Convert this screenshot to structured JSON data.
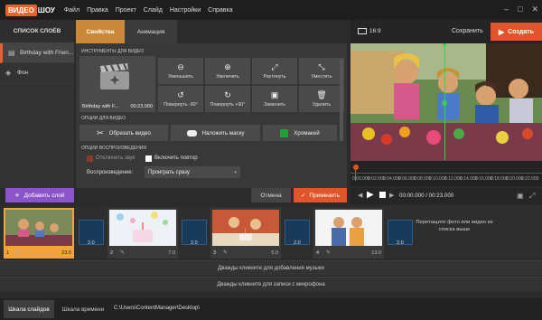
{
  "app": {
    "logo_video": "ВИДЕО",
    "logo_show": "ШОУ"
  },
  "menu": [
    "Файл",
    "Правка",
    "Проект",
    "Слайд",
    "Настройки",
    "Справка"
  ],
  "window_controls": {
    "minimize": "–",
    "maximize": "□",
    "close": "✕"
  },
  "layers": {
    "header": "СПИСОК СЛОЁВ",
    "items": [
      {
        "label": "Birthday with Frien...",
        "icon": "film-icon",
        "selected": true
      },
      {
        "label": "Фон",
        "icon": "paint-bucket-icon",
        "selected": false
      }
    ]
  },
  "tabs": {
    "properties": "Свойства",
    "animation": "Анимация"
  },
  "video_tools": {
    "section": "ИНСТРУМЕНТЫ ДЛЯ ВИДЕО",
    "clip_name": "Birthday with F...",
    "clip_time": "00:23.000",
    "buttons": [
      {
        "label": "Уменьшить",
        "icon": "zoom-out-icon"
      },
      {
        "label": "Увеличить",
        "icon": "zoom-in-icon"
      },
      {
        "label": "Растянуть",
        "icon": "stretch-icon"
      },
      {
        "label": "Уместить",
        "icon": "fit-icon"
      },
      {
        "label": "Повернуть -90°",
        "icon": "rotate-left-icon"
      },
      {
        "label": "Повернуть +90°",
        "icon": "rotate-right-icon"
      },
      {
        "label": "Заменить",
        "icon": "replace-icon"
      },
      {
        "label": "Удалить",
        "icon": "trash-icon"
      }
    ]
  },
  "video_options": {
    "section": "ОПЦИИ ДЛЯ ВИДЕО",
    "trim": "Обрезать видео",
    "mask": "Наложить маску",
    "chroma": "Хромакей"
  },
  "playback": {
    "section": "ОПЦИИ ВОСПРОИЗВЕДЕНИЯ",
    "mute_label": "Отключить звук",
    "mute_checked": true,
    "repeat_label": "Включить повтор",
    "repeat_checked": false,
    "mode_label": "Воспроизведение:",
    "mode_value": "Проиграть сразу"
  },
  "preview": {
    "ratio": "16:9",
    "save": "Сохранить",
    "create": "Создать",
    "ticks": [
      "0:00.000",
      "0:02.000",
      "0:04.000",
      "0:06.000",
      "0:08.000",
      "0:10.000",
      "0:12.000",
      "0:14.000",
      "0:16.000",
      "0:18.000",
      "0:20.000",
      "0:22.000"
    ],
    "timecode": "00:00.000 / 00:23.000"
  },
  "actions": {
    "add_layer": "Добавить слой",
    "cancel": "Отмена",
    "apply": "Применить"
  },
  "slides": [
    {
      "num": "1",
      "dur": "23.0",
      "selected": true
    },
    {
      "num": "2",
      "dur": "7.0",
      "selected": false
    },
    {
      "num": "3",
      "dur": "5.0",
      "selected": false
    },
    {
      "num": "4",
      "dur": "13.0",
      "selected": false
    }
  ],
  "transitions": [
    "2.0",
    "2.0",
    "2.0",
    "2.0"
  ],
  "drop_hint": "Перетащите фото или видео из списка выше",
  "audio": {
    "music": "Дважды кликните для добавления музыки",
    "mic": "Дважды кликните для записи с микрофона"
  },
  "bottom": {
    "slides_tab": "Шкала слайдов",
    "timeline_tab": "Шкала времени",
    "path": "C:\\Users\\ContentManager\\Desktop\\"
  },
  "colors": {
    "accent": "#e8632b",
    "tab_active": "#c9883a",
    "add_layer": "#8b55c9",
    "chroma_swatch": "#1fa23a"
  }
}
